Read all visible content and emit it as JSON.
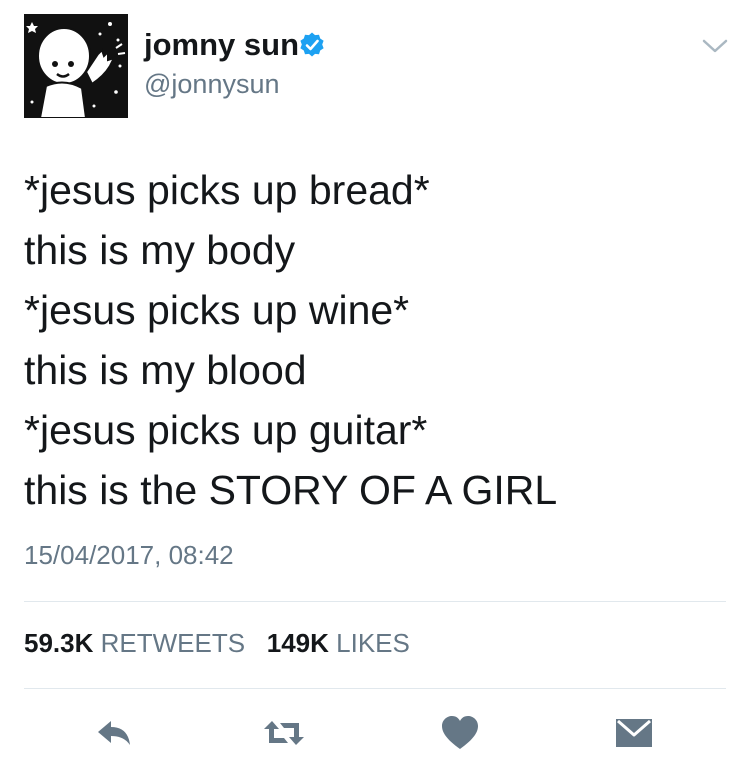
{
  "author": {
    "display_name": "jomny sun",
    "handle": "@jonnysun",
    "verified": true,
    "avatar_icon": "cartoon-alien-avatar"
  },
  "tweet": {
    "lines": [
      "*jesus picks up bread*",
      "this is my body",
      "*jesus picks up wine*",
      "this is my blood",
      "*jesus picks up guitar*",
      "this is the STORY OF A GIRL"
    ],
    "timestamp": "15/04/2017, 08:42"
  },
  "stats": {
    "retweets_count": "59.3K",
    "retweets_label": "RETWEETS",
    "likes_count": "149K",
    "likes_label": "LIKES"
  },
  "actions": [
    {
      "name": "reply",
      "icon": "reply-icon"
    },
    {
      "name": "retweet",
      "icon": "retweet-icon"
    },
    {
      "name": "like",
      "icon": "heart-icon"
    },
    {
      "name": "message",
      "icon": "envelope-icon"
    }
  ],
  "colors": {
    "text": "#14171a",
    "secondary": "#657786",
    "verified": "#1da1f2",
    "action_icons": "#657786",
    "divider": "#e1e8ed"
  }
}
